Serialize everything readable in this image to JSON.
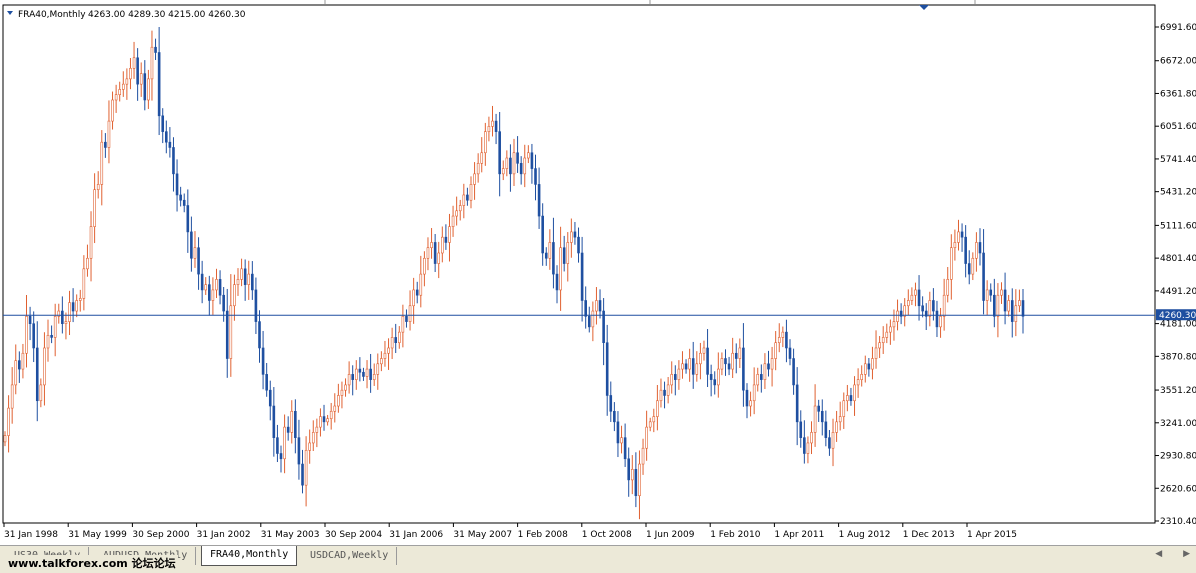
{
  "header": {
    "symbol": "FRA40,Monthly",
    "ohlc": "4263.00 4289.30 4215.00 4260.30"
  },
  "price_axis": {
    "labels": [
      "6991.60",
      "6672.00",
      "6361.80",
      "6051.60",
      "5741.40",
      "5431.20",
      "5111.60",
      "4801.40",
      "4491.20",
      "4181.00",
      "3870.80",
      "3551.20",
      "3241.00",
      "2930.80",
      "2620.60",
      "2310.40"
    ],
    "current_price": "4260.30"
  },
  "time_axis": {
    "labels": [
      "31 Jan 1998",
      "31 May 1999",
      "30 Sep 2000",
      "31 Jan 2002",
      "31 May 2003",
      "30 Sep 2004",
      "31 Jan 2006",
      "31 May 2007",
      "1 Feb 2008",
      "1 Oct 2008",
      "1 Jun 2009",
      "1 Feb 2010",
      "1 Apr 2011",
      "1 Aug 2012",
      "1 Dec 2013",
      "1 Apr 2015"
    ]
  },
  "tabs": [
    {
      "label": "US30,Weekly",
      "active": false
    },
    {
      "label": "AUDUSD,Monthly",
      "active": false
    },
    {
      "label": "FRA40,Monthly",
      "active": true
    },
    {
      "label": "USDCAD,Weekly",
      "active": false
    }
  ],
  "watermark": "www.talkforex.com 论坛论坛",
  "colors": {
    "bull": "#e06030",
    "bear": "#1e4fa0",
    "axis": "#000000",
    "price_line": "#1e4fa0",
    "price_tag_bg": "#1e4fa0"
  },
  "chart_data": {
    "type": "candlestick",
    "title": "FRA40,Monthly",
    "ylim": [
      2310.4,
      6991.6
    ],
    "x_range": [
      "Jan 1998",
      "Jul 2016"
    ],
    "current_price": 4260.3,
    "closes": [
      3120,
      3380,
      3600,
      3830,
      3750,
      3900,
      4250,
      4180,
      3950,
      3450,
      3600,
      3950,
      4070,
      4050,
      4250,
      4300,
      4180,
      4200,
      4380,
      4300,
      4400,
      4420,
      4700,
      4800,
      5100,
      5450,
      5500,
      5900,
      5850,
      6100,
      6300,
      6350,
      6400,
      6450,
      6500,
      6600,
      6700,
      6450,
      6550,
      6300,
      6500,
      6800,
      6750,
      6150,
      6000,
      5900,
      5850,
      5600,
      5400,
      5350,
      5300,
      5050,
      4800,
      4900,
      4650,
      4500,
      4550,
      4400,
      4500,
      4600,
      4450,
      4300,
      3850,
      4350,
      4550,
      4600,
      4700,
      4550,
      4650,
      4500,
      4200,
      3950,
      3700,
      3550,
      3400,
      3100,
      2950,
      2900,
      3200,
      3150,
      3350,
      3100,
      2850,
      2650,
      2980,
      3050,
      3150,
      3200,
      3300,
      3250,
      3280,
      3350,
      3400,
      3500,
      3550,
      3600,
      3700,
      3650,
      3750,
      3720,
      3680,
      3750,
      3650,
      3700,
      3800,
      3850,
      3900,
      3950,
      4050,
      4000,
      4100,
      4250,
      4200,
      4350,
      4500,
      4450,
      4650,
      4800,
      4900,
      4950,
      4750,
      4850,
      5000,
      4950,
      5100,
      5200,
      5250,
      5300,
      5400,
      5350,
      5500,
      5600,
      5700,
      5800,
      6000,
      6050,
      6100,
      6000,
      5600,
      5650,
      5750,
      5600,
      5800,
      5700,
      5600,
      5750,
      5800,
      5650,
      5500,
      5200,
      4850,
      4800,
      4950,
      4650,
      4500,
      4900,
      4750,
      4950,
      5050,
      5000,
      4850,
      4400,
      4250,
      4150,
      4300,
      4400,
      4300,
      4000,
      3500,
      3350,
      3250,
      3050,
      3100,
      2900,
      2700,
      2800,
      2550,
      2850,
      3000,
      3200,
      3250,
      3300,
      3450,
      3550,
      3500,
      3600,
      3700,
      3650,
      3750,
      3800,
      3750,
      3850,
      3700,
      3800,
      3900,
      3950,
      3700,
      3650,
      3600,
      3750,
      3850,
      3800,
      3750,
      3900,
      3850,
      3950,
      3550,
      3400,
      3450,
      3600,
      3700,
      3650,
      3800,
      3750,
      3850,
      4000,
      4050,
      4100,
      3950,
      3850,
      3600,
      3250,
      3100,
      2950,
      3050,
      3150,
      3400,
      3350,
      3250,
      3100,
      3000,
      3150,
      3250,
      3300,
      3450,
      3500,
      3450,
      3600,
      3650,
      3700,
      3800,
      3750,
      3850,
      3950,
      4000,
      4050,
      4100,
      4150,
      4200,
      4300,
      4250,
      4350,
      4400,
      4450,
      4500,
      4350,
      4300,
      4250,
      4400,
      4300,
      4150,
      4250,
      4450,
      4600,
      4900,
      4950,
      5050,
      5000,
      4750,
      4650,
      4800,
      4950,
      4850,
      4400,
      4500,
      4450,
      4250,
      4450,
      4500,
      4300,
      4400,
      4200,
      4350,
      4400,
      4250
    ]
  }
}
